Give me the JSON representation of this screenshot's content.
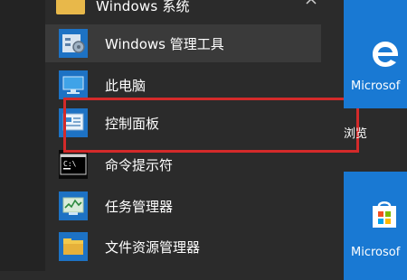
{
  "group": {
    "label": "Windows 系统"
  },
  "items": [
    {
      "label": "Windows 管理工具",
      "icon": "admin-tools-icon"
    },
    {
      "label": "此电脑",
      "icon": "computer-icon"
    },
    {
      "label": "控制面板",
      "icon": "control-panel-icon"
    },
    {
      "label": "命令提示符",
      "icon": "command-prompt-icon"
    },
    {
      "label": "任务管理器",
      "icon": "task-manager-icon"
    },
    {
      "label": "文件资源管理器",
      "icon": "file-explorer-icon"
    }
  ],
  "tiles": {
    "edge_label": "Microsof",
    "browse_label": "浏览",
    "store_label": "Microsof"
  },
  "colors": {
    "tile_blue": "#1979d3",
    "highlight": "#d42a2a",
    "folder": "#e8b84a"
  }
}
